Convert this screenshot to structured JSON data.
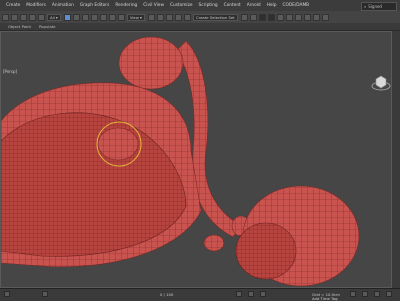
{
  "menubar": {
    "items": [
      "Create",
      "Modifiers",
      "Animation",
      "Graph Editors",
      "Rendering",
      "Civil View",
      "Customize",
      "Scripting",
      "Content",
      "Arnold",
      "Help",
      "CODE/DAMB"
    ],
    "search_placeholder": "Signed"
  },
  "toolbar": {
    "selection_set_label": "Create Selection Set"
  },
  "ribbon": {
    "items": [
      "Object Paint",
      "Populate"
    ]
  },
  "viewport": {
    "label": "[Persp]",
    "background": "#464646",
    "mesh_color": "#c9534f",
    "wire_color": "#7a2a27"
  },
  "status": {
    "grid_text": "Grid = 10.0cm",
    "add_time_tag": "Add Time Tag",
    "frame_counter": "0 / 100"
  }
}
